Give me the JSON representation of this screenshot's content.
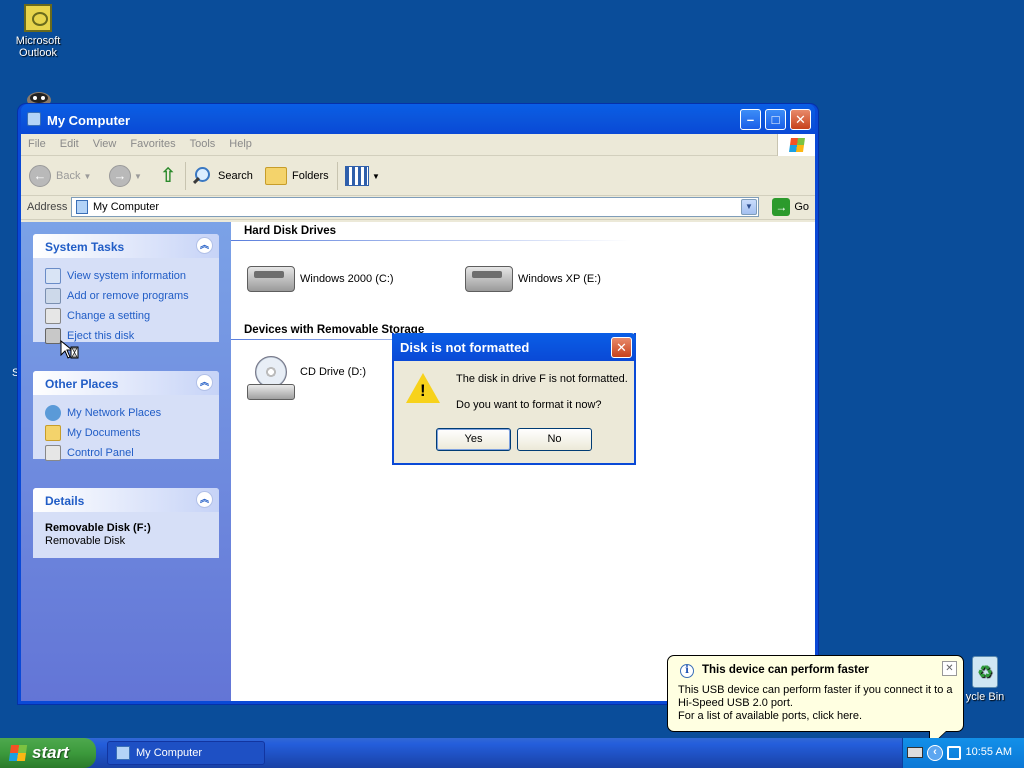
{
  "desktop": {
    "icons": [
      {
        "label": "Microsoft Outlook",
        "icon": "outlook-icon"
      },
      {
        "label": "ycle Bin",
        "icon": "recycle-bin-icon"
      }
    ],
    "edge_char": "S"
  },
  "explorer": {
    "title": "My Computer",
    "menu": [
      "File",
      "Edit",
      "View",
      "Favorites",
      "Tools",
      "Help"
    ],
    "toolbar": {
      "back_label": "Back",
      "search_label": "Search",
      "folders_label": "Folders"
    },
    "address": {
      "label": "Address",
      "value": "My Computer",
      "go_label": "Go"
    },
    "sidebar": {
      "system_tasks": {
        "title": "System Tasks",
        "items": [
          "View system information",
          "Add or remove programs",
          "Change a setting",
          "Eject this disk"
        ]
      },
      "other_places": {
        "title": "Other Places",
        "items": [
          "My Network Places",
          "My Documents",
          "Control Panel"
        ]
      },
      "details": {
        "title": "Details",
        "name": "Removable Disk (F:)",
        "type": "Removable Disk"
      }
    },
    "content": {
      "groups": [
        {
          "title": "Hard Disk Drives",
          "items": [
            "Windows 2000 (C:)",
            "Windows XP (E:)"
          ]
        },
        {
          "title": "Devices with Removable Storage",
          "items": [
            "CD Drive (D:)"
          ]
        }
      ]
    }
  },
  "dialog": {
    "title": "Disk is not formatted",
    "message": "The disk in drive F is not formatted.",
    "question": "Do you want to format it now?",
    "yes_label": "Yes",
    "no_label": "No"
  },
  "taskbar": {
    "start_label": "start",
    "task_button_label": "My Computer",
    "clock": "10:55 AM"
  },
  "balloon": {
    "title": "This device can perform faster",
    "line1": "This USB device can perform faster if you connect it to a",
    "line2": "Hi-Speed USB 2.0 port.",
    "line3": "For a list of available ports, click here."
  },
  "colors": {
    "desktop": "#0a4d9a",
    "titlebar": "#0a49d6",
    "sidebar_link": "#215dc6",
    "balloon_bg": "#ffffe1"
  }
}
